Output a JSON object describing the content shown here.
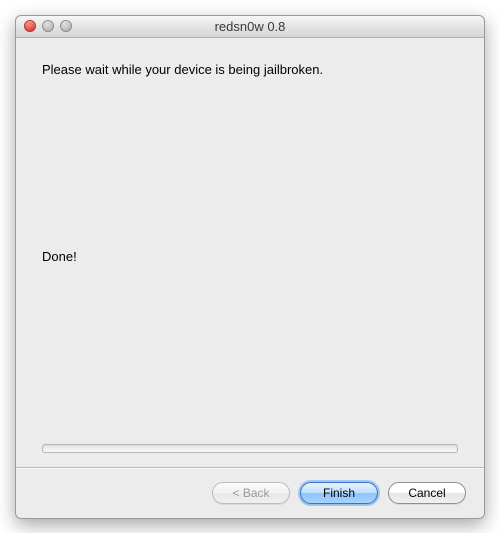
{
  "window": {
    "title": "redsn0w 0.8"
  },
  "content": {
    "instruction": "Please wait while your device is being jailbroken.",
    "status": "Done!"
  },
  "footer": {
    "back_label": "< Back",
    "finish_label": "Finish",
    "cancel_label": "Cancel"
  }
}
